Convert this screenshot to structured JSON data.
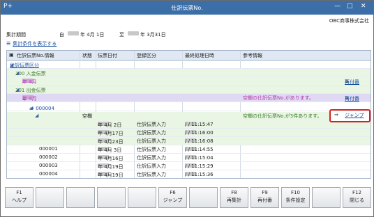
{
  "window": {
    "title": "仕訳伝票No.",
    "app_icon": "P+",
    "minimize": "—",
    "maximize": "□",
    "close": "✕"
  },
  "company": "OBC商事株式会社",
  "period": {
    "label": "集計期間",
    "from_label": "自",
    "from_value": "年 4月 1日",
    "to_label": "至",
    "to_value": "年 3月31日"
  },
  "show_conditions": "集計条件を表示する",
  "columns": {
    "voucher": "仕訳伝票No.情報",
    "status": "状態",
    "date": "伝票日付",
    "register": "登録区分",
    "last_processed": "最終処理日時",
    "info": "参考情報"
  },
  "tree": {
    "root": "仕訳伝票区分",
    "deposit": "100  入金伝票",
    "deposit_year": "年  4月",
    "reissue": "再付番",
    "withdraw": "101  出金伝票",
    "withdraw_year": "年  4月",
    "withdraw_info": "空欄の仕訳伝票No.があります。",
    "range": "～ 000004",
    "blank_status": "空欄",
    "blank_info": "空欄の仕訳伝票No.が3件あります。",
    "jump_link": "ジャンプ"
  },
  "rows": [
    {
      "no": "",
      "date": "年  4月  2日",
      "register": "仕訳伝票入力",
      "time": "/   /   11:15:47"
    },
    {
      "no": "",
      "date": "年  4月17日",
      "register": "仕訳伝票入力",
      "time": "/   /   11:16:00"
    },
    {
      "no": "",
      "date": "年  4月23日",
      "register": "仕訳伝票入力",
      "time": "/   /   11:16:08"
    },
    {
      "no": "000001",
      "date": "年  4月  3日",
      "register": "仕訳伝票入力",
      "time": "/   /   11:14:55"
    },
    {
      "no": "000002",
      "date": "年  4月16日",
      "register": "仕訳伝票入力",
      "time": "/   /   11:15:04"
    },
    {
      "no": "000003",
      "date": "年  4月19日",
      "register": "仕訳伝票入力",
      "time": "/   /   11:15:29"
    },
    {
      "no": "000004",
      "date": "年  4月19日",
      "register": "仕訳伝票入力",
      "time": "/   /   11:15:36"
    }
  ],
  "fkeys": [
    {
      "key": "F1",
      "label": "ヘルプ"
    },
    {
      "key": "",
      "label": ""
    },
    {
      "key": "",
      "label": ""
    },
    {
      "key": "",
      "label": ""
    },
    {
      "key": "",
      "label": ""
    },
    {
      "key": "F6",
      "label": "ジャンプ"
    },
    {
      "key": "",
      "label": ""
    },
    {
      "key": "F8",
      "label": "再集計"
    },
    {
      "key": "F9",
      "label": "再付番"
    },
    {
      "key": "F10",
      "label": "条件設定"
    },
    {
      "key": "",
      "label": ""
    },
    {
      "key": "F12",
      "label": "閉じる"
    }
  ],
  "colors": {
    "title_bar": "#3c6fa8",
    "jump_highlight": "#d62020",
    "deposit_green": "#eaf6e4",
    "purple_row": "#e0d9f4"
  }
}
